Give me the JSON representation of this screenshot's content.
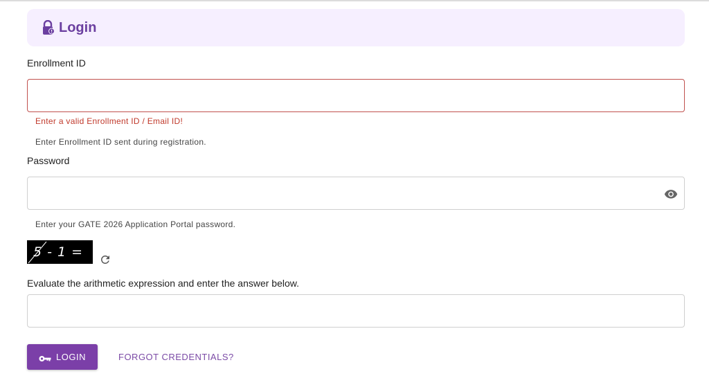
{
  "header": {
    "title": "Login",
    "icon": "lock-icon",
    "accent_color": "#6b3fa0"
  },
  "enrollment": {
    "label": "Enrollment ID",
    "value": "",
    "error": "Enter a valid Enrollment ID / Email ID!",
    "helper": "Enter Enrollment ID sent during registration."
  },
  "password": {
    "label": "Password",
    "value": "",
    "helper": "Enter your GATE 2026 Application Portal password.",
    "toggle_icon": "eye-icon"
  },
  "captcha": {
    "expression": "5 - 1 =",
    "refresh_icon": "refresh-icon",
    "instruction": "Evaluate the arithmetic expression and enter the answer below.",
    "value": ""
  },
  "actions": {
    "login_label": "LOGIN",
    "login_icon": "key-icon",
    "forgot_label": "FORGOT CREDENTIALS?",
    "button_color": "#7b3fa8"
  }
}
